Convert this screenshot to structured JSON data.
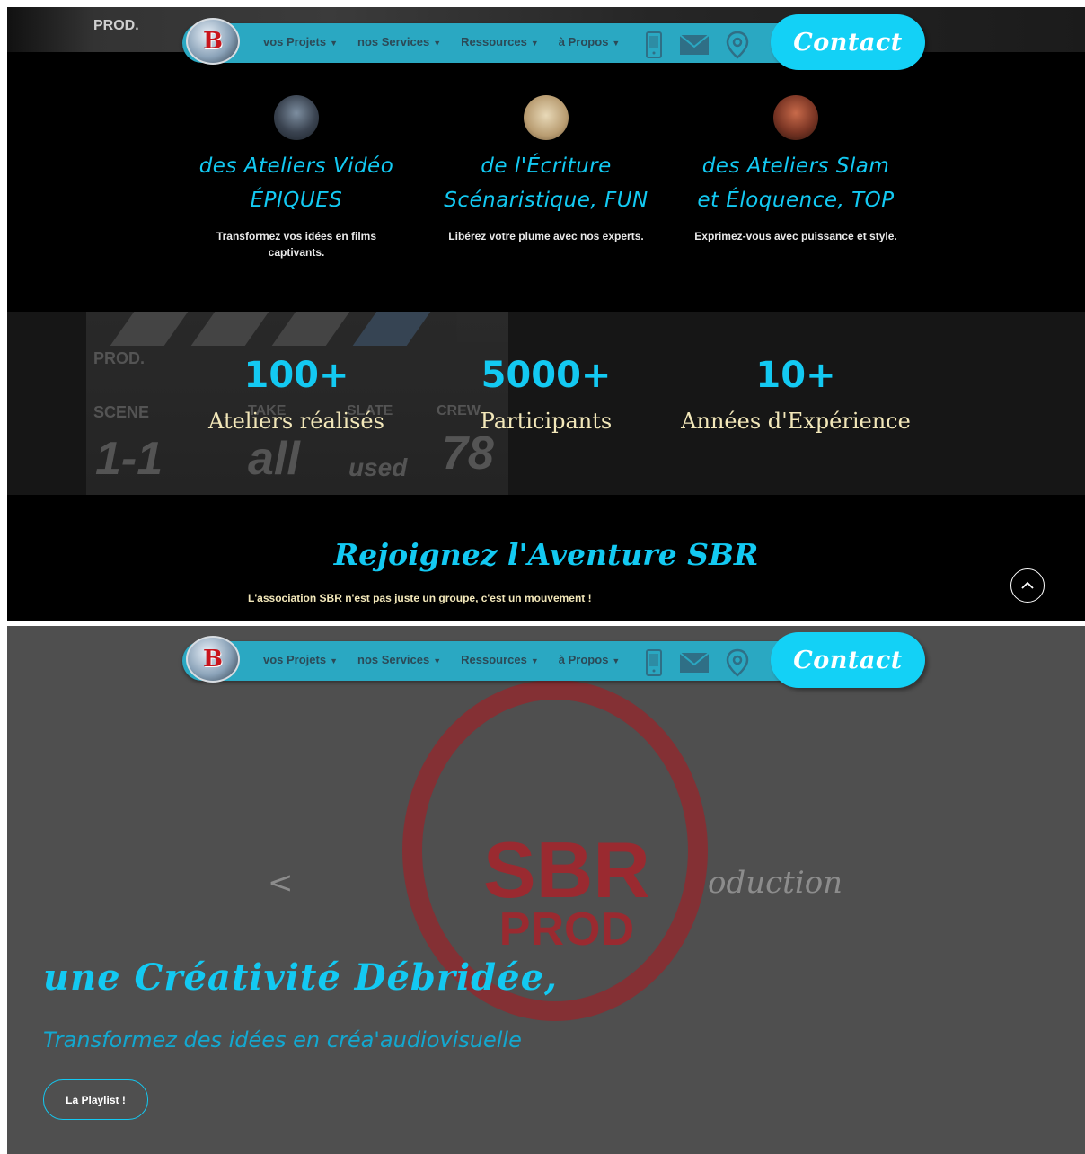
{
  "nav": {
    "logo_text": "B",
    "menu": [
      {
        "label": "vos Projets"
      },
      {
        "label": "nos Services"
      },
      {
        "label": "Ressources"
      },
      {
        "label": "à Propos"
      }
    ],
    "icons": [
      "phone-icon",
      "envelope-icon",
      "location-pin-icon"
    ],
    "contact_label": "Contact"
  },
  "hero_strip": {
    "slate_text": "PROD."
  },
  "features": [
    {
      "title_line1": "des Ateliers Vidéo",
      "title_line2": "ÉPIQUES",
      "text": "Transformez vos idées en films captivants."
    },
    {
      "title_line1": "de l'Écriture",
      "title_line2": "Scénaristique, FUN",
      "text": "Libérez votre plume avec nos experts."
    },
    {
      "title_line1": "des Ateliers Slam",
      "title_line2": "et Éloquence, TOP",
      "text": "Exprimez-vous avec puissance et style."
    }
  ],
  "stats": {
    "slate": {
      "prod": "PROD.",
      "scene": "SCENE",
      "take": "TAKE",
      "slate": "SLATE",
      "crew": "CREW",
      "v1": "1-1",
      "v2": "all",
      "v3": "used",
      "v4": "78"
    },
    "items": [
      {
        "number": "100+",
        "label": "Ateliers réalisés"
      },
      {
        "number": "5000+",
        "label": "Participants"
      },
      {
        "number": "10+",
        "label": "Années d'Expérience"
      }
    ]
  },
  "join": {
    "title": "Rejoignez l'Aventure SBR",
    "text": "L'association SBR n'est pas juste un groupe, c'est un mouvement !"
  },
  "hero": {
    "watermark_line1": "SBR",
    "watermark_line2": "PROD",
    "watermark_left": "<",
    "watermark_right": "oduction",
    "title": "une Créativité Débridée,",
    "subtitle": "Transformez des idées en créa'audiovisuelle",
    "button_label": "La Playlist !"
  },
  "colors": {
    "accent": "#13c9f2",
    "nav_bar": "#2aa8c2",
    "contact_button": "#13d1f6",
    "stat_label": "#f2e7b9",
    "hero_background": "#4f4f4f"
  }
}
